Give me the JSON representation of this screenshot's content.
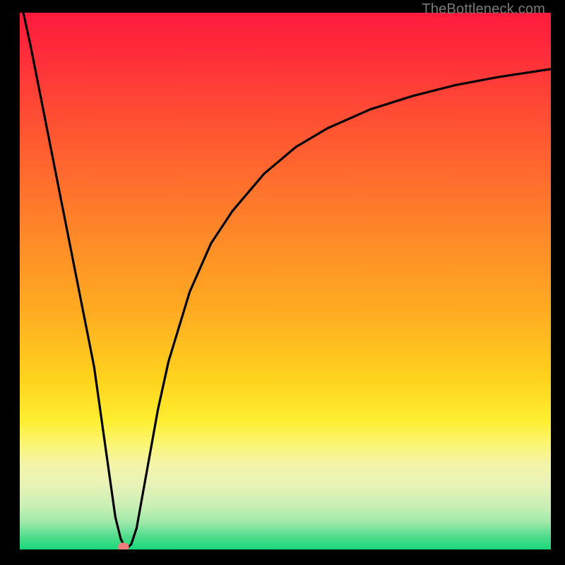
{
  "watermark": "TheBottleneck.com",
  "chart_data": {
    "type": "line",
    "title": "",
    "xlabel": "",
    "ylabel": "",
    "xlim": [
      0,
      100
    ],
    "ylim": [
      0,
      100
    ],
    "x": [
      0,
      2,
      4,
      6,
      8,
      10,
      12,
      14,
      16,
      18,
      19,
      20,
      21,
      22,
      24,
      26,
      28,
      32,
      36,
      40,
      46,
      52,
      58,
      66,
      74,
      82,
      90,
      100
    ],
    "y": [
      103,
      94,
      84,
      74,
      64,
      54,
      44,
      34,
      20,
      6,
      2,
      0,
      1,
      4,
      15,
      26,
      35,
      48,
      57,
      63,
      70,
      75,
      78.5,
      82,
      84.5,
      86.5,
      88,
      89.5
    ],
    "notch_axis": "x",
    "notch_position": 20,
    "marker": {
      "x": 19.5,
      "y": 0.5
    },
    "background_gradient": {
      "direction": "top-to-bottom",
      "stops": [
        {
          "pos": 0.0,
          "color": "#ff1a3c"
        },
        {
          "pos": 0.3,
          "color": "#ff6a2e"
        },
        {
          "pos": 0.55,
          "color": "#ffaa22"
        },
        {
          "pos": 0.76,
          "color": "#ffee30"
        },
        {
          "pos": 0.92,
          "color": "#c8efb4"
        },
        {
          "pos": 1.0,
          "color": "#18d77a"
        }
      ]
    }
  }
}
